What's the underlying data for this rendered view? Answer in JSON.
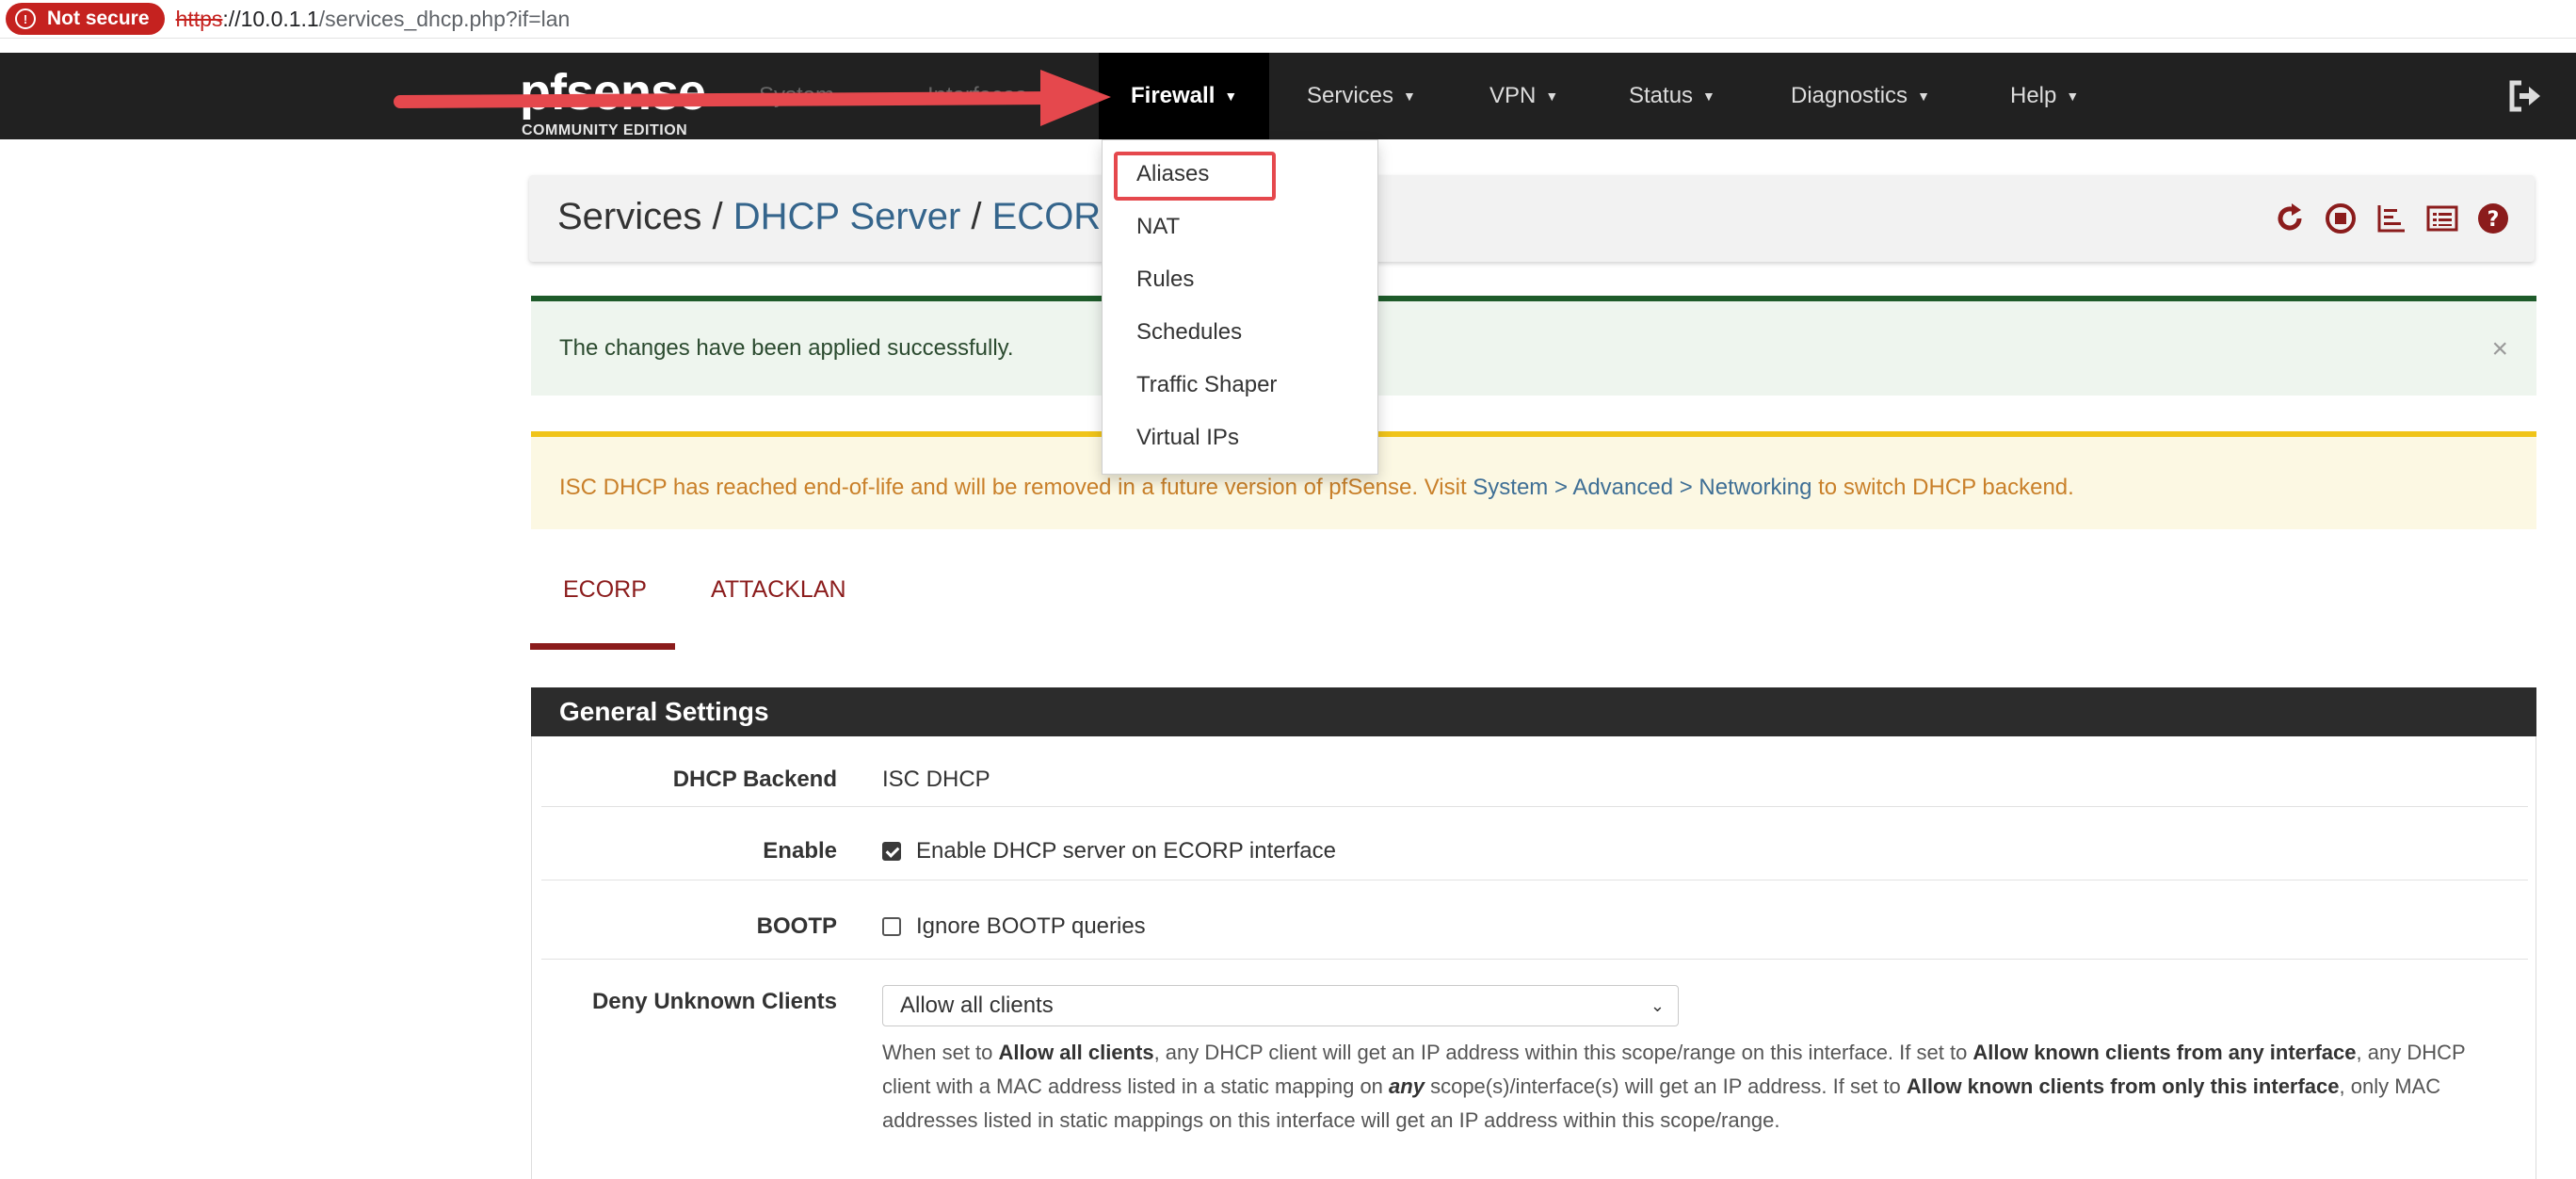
{
  "browser": {
    "security_label": "Not secure",
    "url_scheme": "https",
    "url_host": "://10.0.1.1",
    "url_path": "/services_dhcp.php?if=lan"
  },
  "navbar": {
    "logo_text": "pfsense",
    "logo_subtitle": "COMMUNITY EDITION",
    "items": [
      {
        "label": "System"
      },
      {
        "label": "Interfaces"
      },
      {
        "label": "Firewall"
      },
      {
        "label": "Services"
      },
      {
        "label": "VPN"
      },
      {
        "label": "Status"
      },
      {
        "label": "Diagnostics"
      },
      {
        "label": "Help"
      }
    ],
    "logout_icon": "sign-out-icon"
  },
  "firewall_menu": {
    "items": [
      "Aliases",
      "NAT",
      "Rules",
      "Schedules",
      "Traffic Shaper",
      "Virtual IPs"
    ],
    "highlighted": "Aliases"
  },
  "breadcrumb": {
    "part1": "Services",
    "sep": " / ",
    "part2": "DHCP Server",
    "part3": "ECORP",
    "icons": [
      "reload-icon",
      "stop-circle-icon",
      "bar-chart-icon",
      "list-icon",
      "help-icon"
    ]
  },
  "alerts": {
    "success": "The changes have been applied successfully.",
    "warning_before": "ISC DHCP has reached end-of-life and will be removed in a future version of pfSense. Visit ",
    "warning_link": "System > Advanced > Networking",
    "warning_after": " to switch DHCP backend."
  },
  "tabs": [
    "ECORP",
    "ATTACKLAN"
  ],
  "general_settings": {
    "title": "General Settings",
    "backend_label": "DHCP Backend",
    "backend_value": "ISC DHCP",
    "enable_label": "Enable",
    "enable_text": "Enable DHCP server on ECORP interface",
    "bootp_label": "BOOTP",
    "bootp_text": "Ignore BOOTP queries",
    "deny_label": "Deny Unknown Clients",
    "deny_value": "Allow all clients",
    "help": {
      "t1": "When set to ",
      "b1": "Allow all clients",
      "t2": ", any DHCP client will get an IP address within this scope/range on this interface. If set to ",
      "b2": "Allow known clients from any interface",
      "t3": ", any DHCP client with a MAC address listed in a static mapping on ",
      "b3": "any",
      "t4": " scope(s)/interface(s) will get an IP address. If set to ",
      "b4": "Allow known clients from only this interface",
      "t5": ", only MAC addresses listed in static mappings on this interface will get an IP address within this scope/range."
    }
  },
  "colors": {
    "navbar_bg": "#212121",
    "accent_red": "#8b1c1c",
    "link_blue": "#35658c",
    "annotation_red": "#e5484d"
  }
}
